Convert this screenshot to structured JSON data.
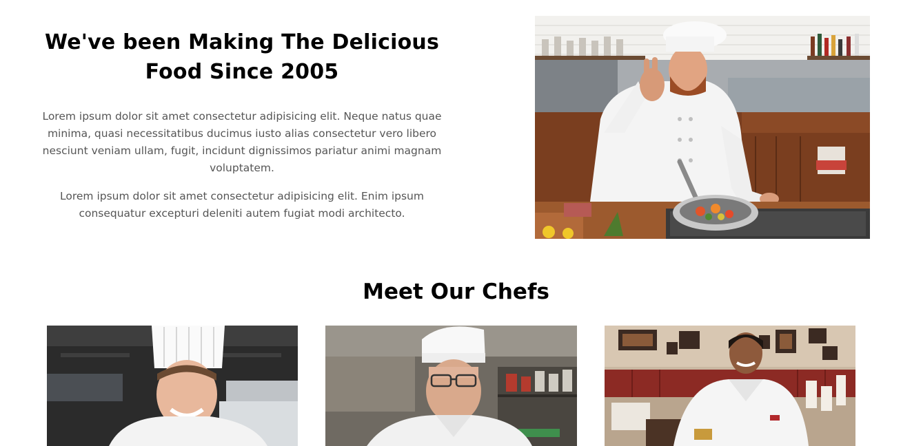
{
  "about": {
    "title": "We've been Making The Delicious Food Since 2005",
    "paragraphs": [
      "Lorem ipsum dolor sit amet consectetur adipisicing elit. Neque natus quae minima, quasi necessitatibus ducimus iusto alias consectetur vero libero nesciunt veniam ullam, fugit, incidunt dignissimos pariatur animi magnam voluptatem.",
      "Lorem ipsum dolor sit amet consectetur adipisicing elit. Enim ipsum consequatur excepturi deleniti autem fugiat modi architecto."
    ]
  },
  "chefs_section": {
    "title": "Meet Our Chefs"
  },
  "colors": {
    "heading": "#000000",
    "body_text": "#555555",
    "background": "#ffffff"
  }
}
